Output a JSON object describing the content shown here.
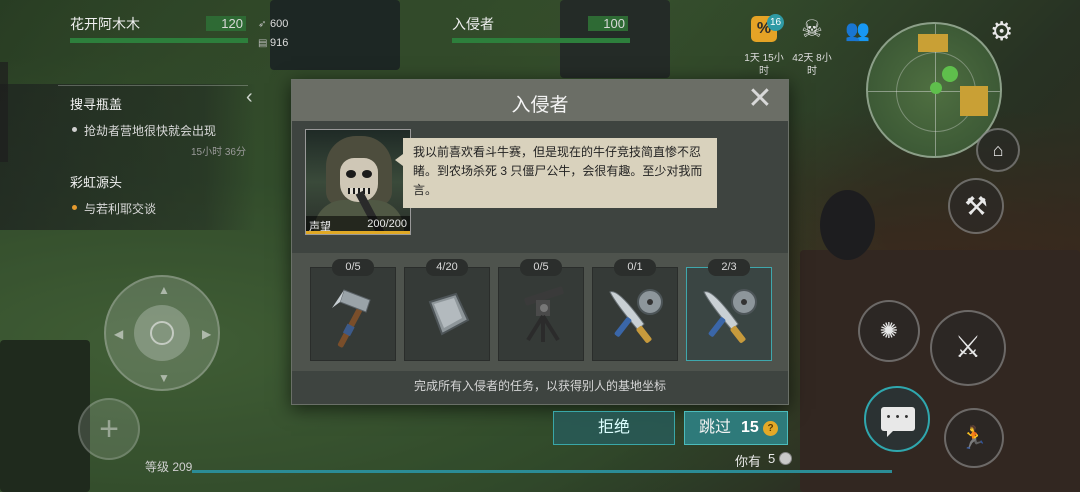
{
  "hud": {
    "player_name": "花开阿木木",
    "player_hp": "120",
    "stat_attack": "600",
    "stat_armor": "916",
    "enemy_name": "入侵者",
    "enemy_hp": "100",
    "badge_count": "16",
    "event_time_1": "1天 15小时",
    "event_time_2": "42天 8小时"
  },
  "quests": [
    {
      "title": "搜寻瓶盖",
      "desc": "抢劫者营地很快就会出现",
      "timer": "15小时 36分"
    },
    {
      "title": "彩虹源头",
      "desc": "与若利耶交谈"
    }
  ],
  "modal": {
    "title": "入侵者",
    "reputation_label": "声望",
    "reputation_value": "200/200",
    "speech": "我以前喜欢看斗牛赛，但是现在的牛仔竞技简直惨不忍睹。到农场杀死 3 只僵尸公牛，会很有趣。至少对我而言。",
    "tasks": [
      {
        "count": "0/5",
        "icon": "hatchet-icon",
        "done": false
      },
      {
        "count": "4/20",
        "icon": "metal-plate-icon",
        "done": false
      },
      {
        "count": "0/5",
        "icon": "mounted-gun-icon",
        "done": false
      },
      {
        "count": "0/1",
        "icon": "machete-sawblade-icon",
        "done": false
      },
      {
        "count": "2/3",
        "icon": "machete-sawblade-icon",
        "done": true
      }
    ],
    "note": "完成所有入侵者的任务，以获得别人的基地坐标",
    "reject_label": "拒绝",
    "skip_label": "跳过",
    "skip_cost": "15",
    "have_label": "你有",
    "have_amount": "5"
  },
  "level_label": "等级 209",
  "colors": {
    "accent_teal": "#2fa7ae",
    "hp_green": "#2d7f3c",
    "gold": "#e3a927"
  }
}
